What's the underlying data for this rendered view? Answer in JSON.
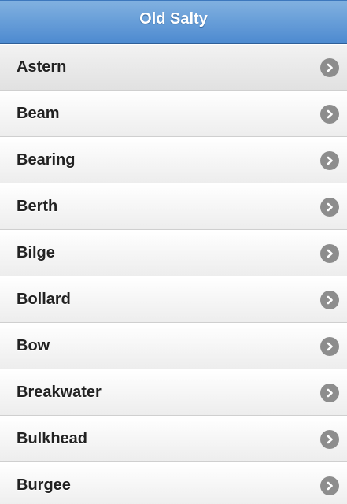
{
  "header": {
    "title": "Old Salty"
  },
  "list": {
    "items": [
      {
        "label": "Astern",
        "icon": "chevron-right-icon"
      },
      {
        "label": "Beam",
        "icon": "chevron-right-icon"
      },
      {
        "label": "Bearing",
        "icon": "chevron-right-icon"
      },
      {
        "label": "Berth",
        "icon": "chevron-right-icon"
      },
      {
        "label": "Bilge",
        "icon": "chevron-right-icon"
      },
      {
        "label": "Bollard",
        "icon": "chevron-right-icon"
      },
      {
        "label": "Bow",
        "icon": "chevron-right-icon"
      },
      {
        "label": "Breakwater",
        "icon": "chevron-right-icon"
      },
      {
        "label": "Bulkhead",
        "icon": "chevron-right-icon"
      },
      {
        "label": "Burgee",
        "icon": "chevron-right-icon"
      }
    ]
  },
  "colors": {
    "header_top": "#81b1e0",
    "header_bottom": "#4d8ad0",
    "item_text": "#222222",
    "chevron_bg": "#8d8d8d"
  }
}
